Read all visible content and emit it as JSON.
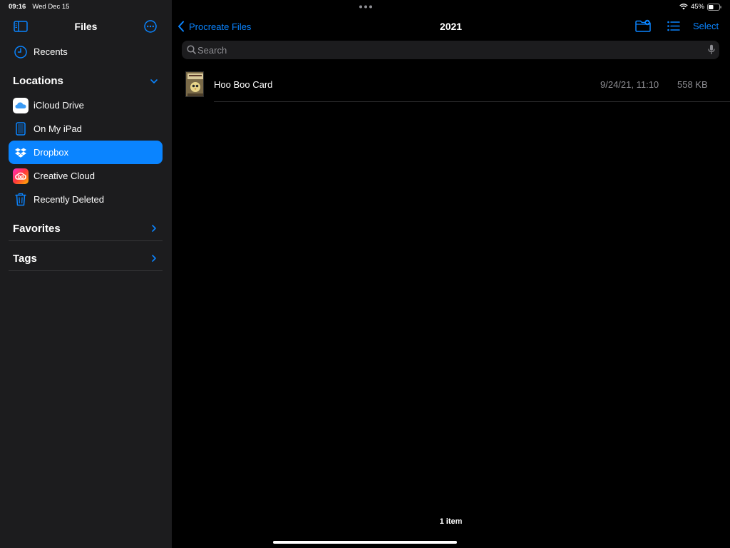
{
  "status": {
    "time": "09:16",
    "date": "Wed Dec 15",
    "battery": "45%"
  },
  "sidebar": {
    "title": "Files",
    "recents_label": "Recents",
    "locations_title": "Locations",
    "locations": [
      {
        "label": "iCloud Drive",
        "icon": "icloud-icon"
      },
      {
        "label": "On My iPad",
        "icon": "ipad-icon"
      },
      {
        "label": "Dropbox",
        "icon": "dropbox-icon",
        "selected": true
      },
      {
        "label": "Creative Cloud",
        "icon": "creative-cloud-icon"
      },
      {
        "label": "Recently Deleted",
        "icon": "trash-icon"
      }
    ],
    "favorites_title": "Favorites",
    "tags_title": "Tags"
  },
  "toolbar": {
    "back_label": "Procreate Files",
    "title": "2021",
    "select_label": "Select"
  },
  "search": {
    "placeholder": "Search"
  },
  "files": [
    {
      "name": "Hoo Boo Card",
      "modified": "9/24/21, 11:10",
      "size": "558 KB"
    }
  ],
  "footer": {
    "count": "1 item"
  },
  "colors": {
    "accent": "#0a84ff",
    "sidebar_bg": "#1c1c1e",
    "main_bg": "#000000"
  }
}
